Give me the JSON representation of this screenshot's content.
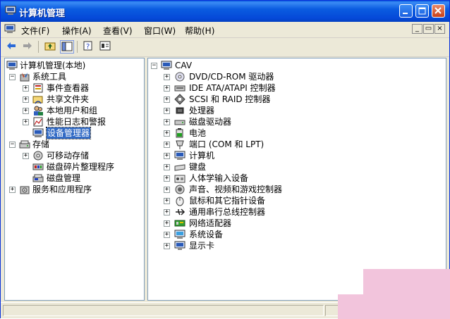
{
  "window": {
    "title": "计算机管理",
    "controls": [
      "minimize",
      "maximize",
      "close"
    ]
  },
  "menubar": {
    "items": [
      "文件(F)",
      "操作(A)",
      "查看(V)",
      "窗口(W)",
      "帮助(H)"
    ]
  },
  "toolbar": {
    "buttons": [
      "back-icon",
      "forward-icon",
      "up-level-icon",
      "show-hide-tree-icon",
      "help-icon",
      "properties-icon"
    ]
  },
  "left_tree": {
    "root": "计算机管理(本地)",
    "system_tools": "系统工具",
    "event_viewer": "事件查看器",
    "shared_folders": "共享文件夹",
    "local_users": "本地用户和组",
    "perf_logs": "性能日志和警报",
    "device_manager": "设备管理器",
    "storage": "存储",
    "removable_storage": "可移动存储",
    "defrag": "磁盘碎片整理程序",
    "disk_management": "磁盘管理",
    "services_apps": "服务和应用程序"
  },
  "right_tree": {
    "root": "CAV",
    "items": [
      "DVD/CD-ROM 驱动器",
      "IDE ATA/ATAPI 控制器",
      "SCSI 和 RAID 控制器",
      "处理器",
      "磁盘驱动器",
      "电池",
      "端口 (COM 和 LPT)",
      "计算机",
      "键盘",
      "人体学输入设备",
      "声音、视频和游戏控制器",
      "鼠标和其它指针设备",
      "通用串行总线控制器",
      "网络适配器",
      "系统设备",
      "显示卡"
    ]
  }
}
